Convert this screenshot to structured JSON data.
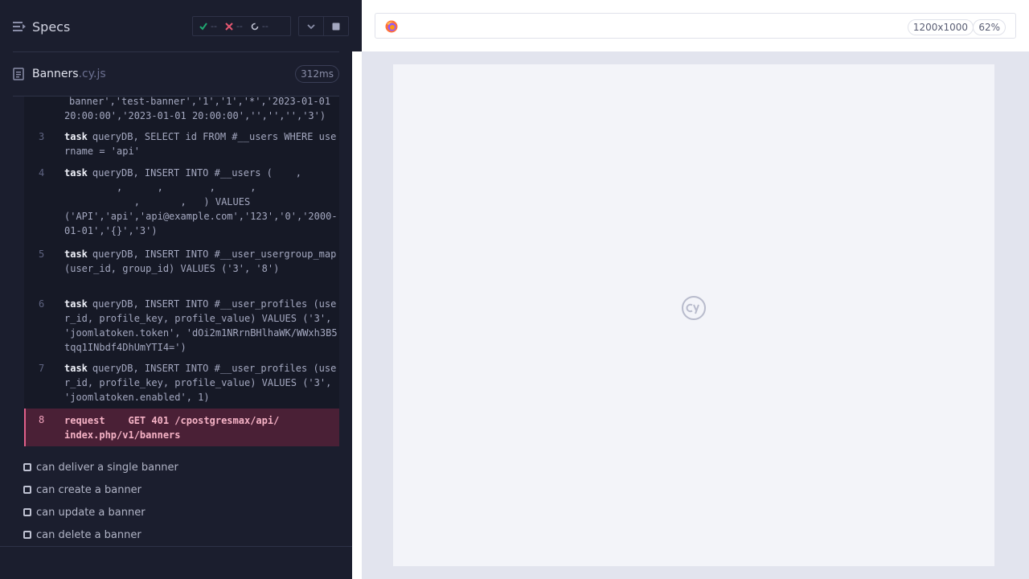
{
  "reporter": {
    "title": "Specs",
    "stats": {
      "passed": "--",
      "failed": "--",
      "pending": "--"
    },
    "spec": {
      "name": "Banners",
      "ext": ".cy.js",
      "duration": "312ms"
    },
    "commands": [
      {
        "num": "",
        "keyword": "",
        "text": "banner','test-banner','1','1','*','2023-01-01 20:00:00','2023-01-01 20:00:00','','','','3')"
      },
      {
        "num": "3",
        "keyword": "task",
        "text": "queryDB, SELECT id FROM #__users WHERE username = 'api'"
      },
      {
        "num": "4",
        "keyword": "task",
        "text": "queryDB, INSERT INTO #__users (    ,\n         ,      ,        ,      ,\n            ,       ,   ) VALUES\n('API','api','api@example.com','123','0','2000-01-01','{}','3')"
      },
      {
        "num": "5",
        "keyword": "task",
        "text": "queryDB, INSERT INTO #__user_usergroup_map (user_id, group_id) VALUES ('3', '8')"
      },
      {
        "num": "6",
        "keyword": "task",
        "text": "queryDB, INSERT INTO #__user_profiles (user_id, profile_key, profile_value) VALUES ('3', 'joomlatoken.token', 'dOi2m1NRrnBHlhaWK/WWxh3B5tqq1INbdf4DhUmYTI4=')"
      },
      {
        "num": "7",
        "keyword": "task",
        "text": "queryDB, INSERT INTO #__user_profiles (user_id, profile_key, profile_value) VALUES ('3', 'joomlatoken.enabled', 1)"
      }
    ],
    "error": {
      "num": "8",
      "text": "request    GET 401 /cpostgresmax/api/\nindex.php/v1/banners"
    },
    "tests": [
      {
        "label": "can deliver a single banner"
      },
      {
        "label": "can create a banner"
      },
      {
        "label": "can update a banner"
      },
      {
        "label": "can delete a banner"
      }
    ]
  },
  "preview": {
    "viewport": "1200x1000",
    "zoom": "62%"
  },
  "colors": {
    "passed": "#1fa971",
    "failed": "#e45770",
    "accent": "#e0608a"
  }
}
